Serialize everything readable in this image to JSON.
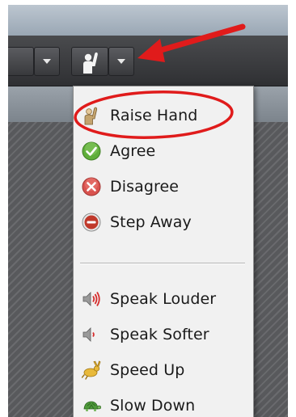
{
  "status_menu": {
    "items": [
      {
        "label": "Raise Hand",
        "icon": "raise-hand-icon"
      },
      {
        "label": "Agree",
        "icon": "agree-check-icon"
      },
      {
        "label": "Disagree",
        "icon": "disagree-x-icon"
      },
      {
        "label": "Step Away",
        "icon": "step-away-icon"
      },
      {
        "label": "Speak Louder",
        "icon": "speak-louder-icon"
      },
      {
        "label": "Speak Softer",
        "icon": "speak-softer-icon"
      },
      {
        "label": "Speed Up",
        "icon": "speed-up-rabbit-icon"
      },
      {
        "label": "Slow Down",
        "icon": "slow-down-turtle-icon"
      }
    ]
  },
  "colors": {
    "annotation": "#e01b1b",
    "agree": "#5fae3a",
    "disagree": "#d9534f",
    "step_away": "#c0392b",
    "toolbar": "#3a3b3e"
  }
}
